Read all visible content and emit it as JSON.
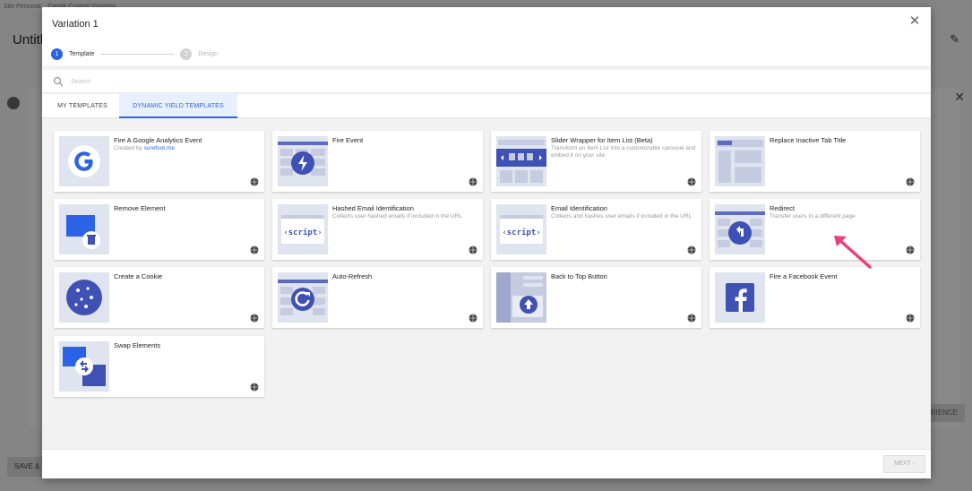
{
  "background": {
    "breadcrumb": "Site Personal...     Create Custom Variation",
    "title": "Untitl",
    "save_label": "SAVE &",
    "right_button": "RIENCE"
  },
  "modal": {
    "title": "Variation 1",
    "close_icon": "close-icon",
    "steps": [
      {
        "number": "1",
        "label": "Template",
        "state": "active"
      },
      {
        "number": "2",
        "label": "Design",
        "state": "inactive"
      }
    ],
    "search": {
      "placeholder": "Search",
      "value": ""
    },
    "tabs": [
      {
        "label": "MY TEMPLATES",
        "active": false
      },
      {
        "label": "DYNAMIC YIELD TEMPLATES",
        "active": true
      }
    ],
    "templates": [
      {
        "title": "Fire A Google Analytics Event",
        "desc_prefix": "Created by ",
        "desc_link": "surefoot.me",
        "icon": "google-icon"
      },
      {
        "title": "Fire Event",
        "desc": "",
        "icon": "lightning-icon"
      },
      {
        "title": "Slider Wrapper for Item List (Beta)",
        "desc": "Transform an Item List into a customizable carousel and embed it on your site",
        "icon": "slider-icon"
      },
      {
        "title": "Replace Inactive Tab Title",
        "desc": "",
        "icon": "browser-tab-icon"
      },
      {
        "title": "Remove Element",
        "desc": "",
        "icon": "trash-icon"
      },
      {
        "title": "Hashed Email Identification",
        "desc": "Collects user hashed emails if included in the URL",
        "icon": "script-icon"
      },
      {
        "title": "Email Identification",
        "desc": "Collects and hashes user emails if included in the URL",
        "icon": "script-icon"
      },
      {
        "title": "Redirect",
        "desc": "Transfer users to a different page",
        "icon": "redirect-icon"
      },
      {
        "title": "Create a Cookie",
        "desc": "",
        "icon": "cookie-icon"
      },
      {
        "title": "Auto-Refresh",
        "desc": "",
        "icon": "refresh-icon"
      },
      {
        "title": "Back to Top Button",
        "desc": "",
        "icon": "arrow-up-icon"
      },
      {
        "title": "Fire a Facebook Event",
        "desc": "",
        "icon": "facebook-icon"
      },
      {
        "title": "Swap Elements",
        "desc": "",
        "icon": "swap-icon"
      }
    ],
    "script_label": "‹script›",
    "next_label": "NEXT ›"
  },
  "colors": {
    "accent": "#2a62e8",
    "thumb_bg": "#dfe4ee",
    "icon_blue": "#3f51b5",
    "arrow": "#e8417a"
  }
}
